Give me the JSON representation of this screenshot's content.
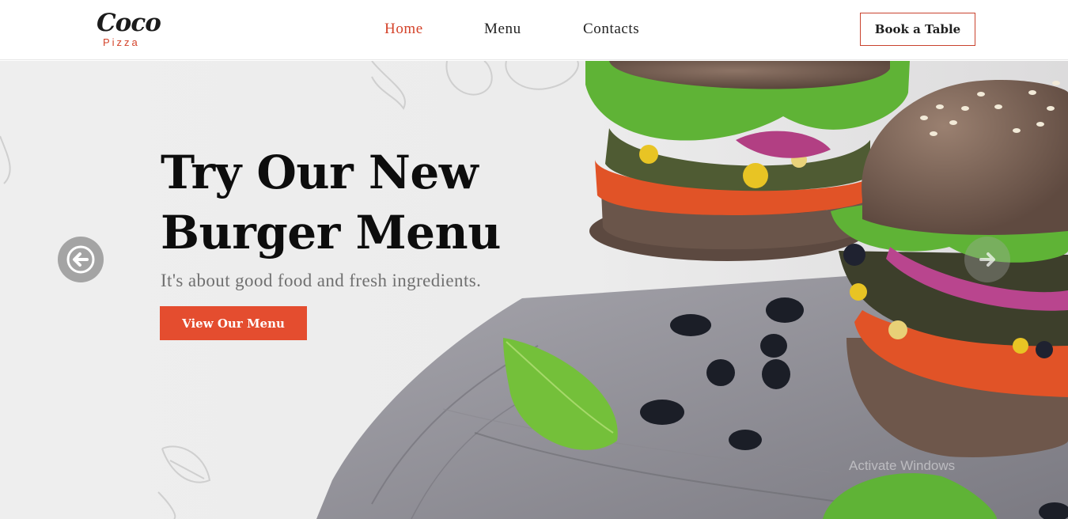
{
  "header": {
    "logo_script": "Coco",
    "logo_sub": "Pizza",
    "nav": [
      {
        "label": "Home",
        "active": true
      },
      {
        "label": "Menu",
        "active": false
      },
      {
        "label": "Contacts",
        "active": false
      }
    ],
    "book_label": "Book a Table"
  },
  "hero": {
    "title_line1": "Try Our New",
    "title_line2": "Burger Menu",
    "subtitle": "It's about good food and fresh ingredients.",
    "cta_label": "View Our Menu",
    "watermark": "Activate Windows"
  },
  "colors": {
    "accent": "#e44d2f",
    "nav_active": "#d4432a",
    "background": "#eeeeee",
    "cloth": "#8e8d94",
    "bun": "#7b6458",
    "lettuce": "#5fb336",
    "tomato": "#e0522a"
  },
  "icons": {
    "prev": "arrow-left-icon",
    "next": "arrow-right-icon"
  }
}
